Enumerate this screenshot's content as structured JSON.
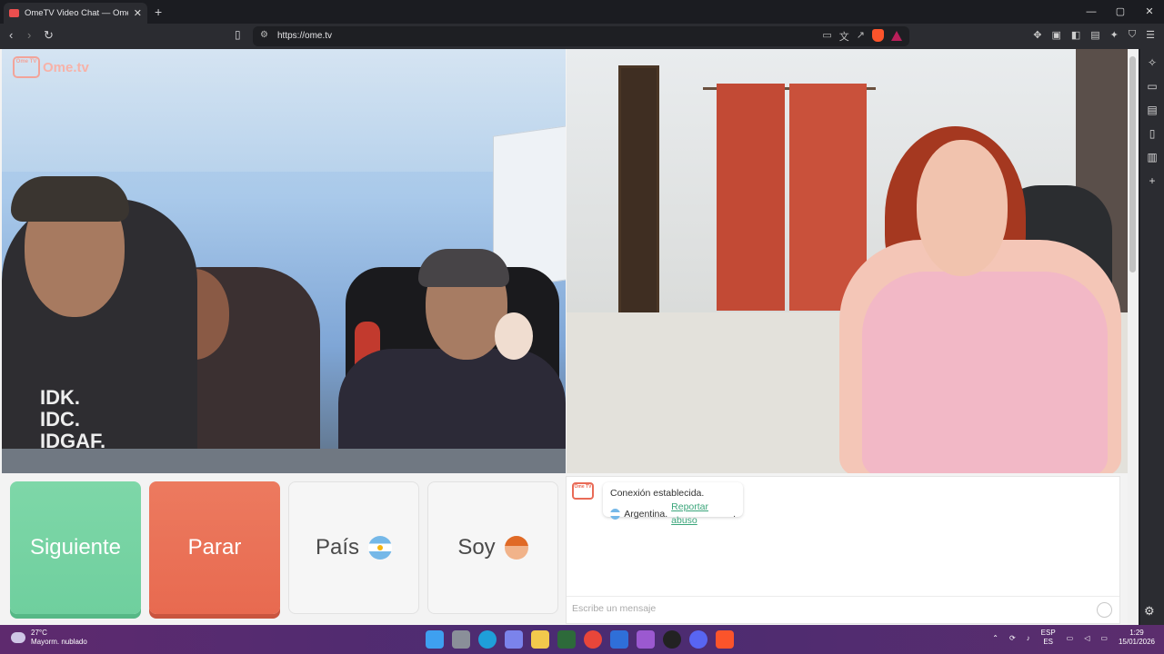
{
  "browser": {
    "tab_title": "OmeTV Video Chat — Omegle",
    "tab_close": "✕",
    "new_tab": "+",
    "url": "https://ome.tv",
    "window_controls": [
      "—",
      "▢",
      "✕"
    ]
  },
  "site": {
    "logo_badge": "Ome TV",
    "logo_name": "Ome.tv"
  },
  "left_video": {
    "shirt_text": "IDK.\nIDC.\nIDGAF."
  },
  "controls": {
    "next_label": "Siguiente",
    "stop_label": "Parar",
    "country_label": "País",
    "gender_label": "Soy"
  },
  "chat": {
    "icon_text": "Ome TV",
    "status": "Conexión establecida.",
    "country": "Argentina.",
    "report": "Reportar abuso",
    "report_suffix": ".",
    "input_placeholder": "Escribe un mensaje"
  },
  "taskbar": {
    "temperature": "27°C",
    "condition": "Mayorm. nublado",
    "language_top": "ESP",
    "language_bottom": "ES",
    "time": "1:29",
    "date": "15/01/2026"
  },
  "colors": {
    "next": "#6fcf9e",
    "stop": "#e86a50",
    "accent_link": "#3aa57a"
  }
}
